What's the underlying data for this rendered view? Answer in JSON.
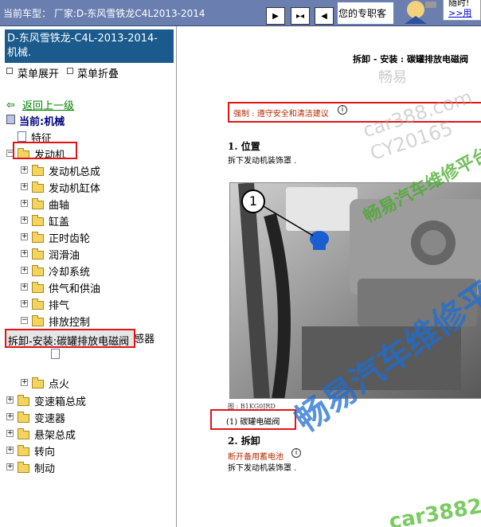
{
  "header": {
    "vehicle_label": "当前车型： 厂家:D-东风雪铁龙C4L2013-2014",
    "expert_label": "您的专职客",
    "ad_line1": "随时!",
    "ad_line2": ">>用",
    "colors": {
      "bar": "#6a7fb0",
      "highlight": "#e21414"
    }
  },
  "sidebar": {
    "title": "D-东风雪铁龙-C4L-2013-2014- 机械.",
    "expand_all": "菜单展开",
    "collapse_all": "菜单折叠",
    "back_link": "返回上一级",
    "current_label": "当前:机械"
  },
  "tree": [
    {
      "label": "特征",
      "type": "doc"
    },
    {
      "label": "发动机",
      "type": "folder",
      "expanded": true
    },
    {
      "label": "发动机总成",
      "type": "folder"
    },
    {
      "label": "发动机缸体",
      "type": "folder"
    },
    {
      "label": "曲轴",
      "type": "folder"
    },
    {
      "label": "缸盖",
      "type": "folder"
    },
    {
      "label": "正时齿轮",
      "type": "folder"
    },
    {
      "label": "润滑油",
      "type": "folder"
    },
    {
      "label": "冷却系统",
      "type": "folder"
    },
    {
      "label": "供气和供油",
      "type": "folder"
    },
    {
      "label": "排气",
      "type": "folder"
    },
    {
      "label": "排放控制",
      "type": "folder",
      "expanded": true
    },
    {
      "label": "拆卸-安装:氧传感器",
      "type": "doc"
    },
    {
      "label": "",
      "type": "doc"
    },
    {
      "label": "点火",
      "type": "folder"
    },
    {
      "label": "变速箱总成",
      "type": "folder"
    },
    {
      "label": "变速器",
      "type": "folder"
    },
    {
      "label": "悬架总成",
      "type": "folder"
    },
    {
      "label": "转向",
      "type": "folder"
    },
    {
      "label": "制动",
      "type": "folder"
    }
  ],
  "current_item": "拆卸-安装:碳罐排放电磁阀",
  "document": {
    "title": "拆卸 - 安装 : 碳罐排放电磁阀",
    "warning": "强制 : 遵守安全和清洁建议",
    "section1_title": "1. 位置",
    "section1_text": "拆下发动机装饰罩 .",
    "callout": "1",
    "figure_label": "图 : B1KG0JRD",
    "legend": "(1) 碳罐电磁阀",
    "section2_title": "2. 拆卸",
    "section2_warning": "断开备用蓄电池",
    "section2_text": "拆下发动机装饰罩 ."
  },
  "watermarks": {
    "w1": "畅易",
    "w2": "car388.com",
    "w3": "CY20165",
    "w4": "畅易汽车维修平台",
    "w5": "畅易汽车维修平台",
    "w6": "car3882"
  }
}
